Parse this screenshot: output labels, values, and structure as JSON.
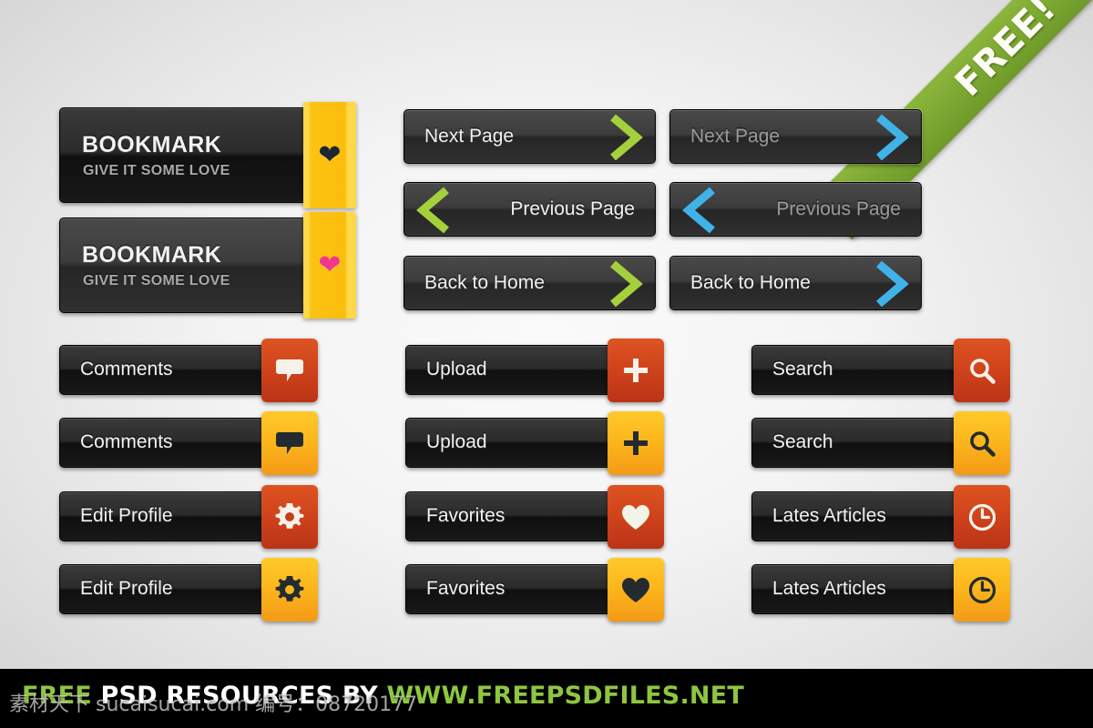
{
  "ribbon": {
    "label": "FREE!",
    "color": "#7da832"
  },
  "bookmarks": [
    {
      "title": "BOOKMARK",
      "subtitle": "GIVE IT SOME LOVE",
      "icon": "heart-icon",
      "variant": "dark",
      "heart_color": "#1d2730"
    },
    {
      "title": "BOOKMARK",
      "subtitle": "GIVE IT SOME LOVE",
      "icon": "heart-icon",
      "variant": "grey",
      "heart_color": "#f0378f"
    }
  ],
  "nav_buttons": [
    {
      "label": "Next Page",
      "direction": "right",
      "accent": "#a4d03c",
      "accent_name": "green",
      "text_state": "bright"
    },
    {
      "label": "Next Page",
      "direction": "right",
      "accent": "#3fb3e8",
      "accent_name": "blue",
      "text_state": "dim"
    },
    {
      "label": "Previous Page",
      "direction": "left",
      "accent": "#a4d03c",
      "accent_name": "green",
      "text_state": "bright"
    },
    {
      "label": "Previous Page",
      "direction": "left",
      "accent": "#3fb3e8",
      "accent_name": "blue",
      "text_state": "dim"
    },
    {
      "label": "Back to Home",
      "direction": "right",
      "accent": "#a4d03c",
      "accent_name": "green",
      "text_state": "bright"
    },
    {
      "label": "Back to Home",
      "direction": "right",
      "accent": "#3fb3e8",
      "accent_name": "blue",
      "text_state": "bright"
    }
  ],
  "icon_buttons": {
    "column_1": [
      {
        "label": "Comments",
        "icon": "speech-bubble-icon",
        "tab_color": "red",
        "icon_fill": "#f6f2ea"
      },
      {
        "label": "Comments",
        "icon": "speech-bubble-icon",
        "tab_color": "yellow",
        "icon_fill": "#232b31"
      },
      {
        "label": "Edit Profile",
        "icon": "gear-icon",
        "tab_color": "red",
        "icon_fill": "#f6f2ea"
      },
      {
        "label": "Edit Profile",
        "icon": "gear-icon",
        "tab_color": "yellow",
        "icon_fill": "#232b31"
      }
    ],
    "column_2": [
      {
        "label": "Upload",
        "icon": "plus-icon",
        "tab_color": "red",
        "icon_fill": "#f6f2ea"
      },
      {
        "label": "Upload",
        "icon": "plus-icon",
        "tab_color": "yellow",
        "icon_fill": "#232b31"
      },
      {
        "label": "Favorites",
        "icon": "heart-icon",
        "tab_color": "red",
        "icon_fill": "#f1f4e6"
      },
      {
        "label": "Favorites",
        "icon": "heart-icon",
        "tab_color": "yellow",
        "icon_fill": "#232b31"
      }
    ],
    "column_3": [
      {
        "label": "Search",
        "icon": "magnifier-icon",
        "tab_color": "red",
        "icon_fill": "#f6f2ea"
      },
      {
        "label": "Search",
        "icon": "magnifier-icon",
        "tab_color": "yellow",
        "icon_fill": "#232b31"
      },
      {
        "label": "Lates Articles",
        "icon": "clock-icon",
        "tab_color": "red",
        "icon_fill": "#f6f2ea"
      },
      {
        "label": "Lates Articles",
        "icon": "clock-icon",
        "tab_color": "yellow",
        "icon_fill": "#232b31"
      }
    ]
  },
  "footer": {
    "free_word": "FREE",
    "mid_text": " PSD RESOURCES BY ",
    "site": "WWW.FREEPSDFILES.NET"
  },
  "watermark": {
    "text": "素材天下 sucaisucai.com 编号：08720177"
  }
}
